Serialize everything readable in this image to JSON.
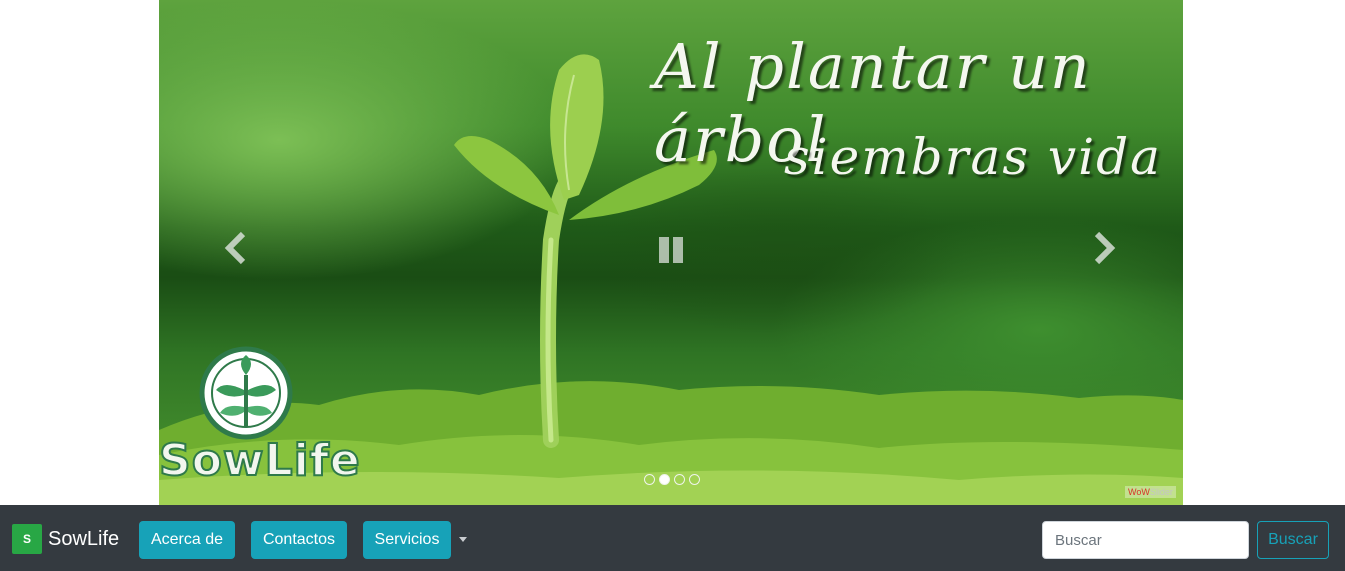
{
  "slider": {
    "quote_line1": "Al plantar un árbol",
    "quote_line2": "siembras vida",
    "logo_text": "SowLife",
    "watermark_brand": "WoW",
    "watermark_suffix": "Slider",
    "bullets": [
      {
        "active": false
      },
      {
        "active": true
      },
      {
        "active": false
      },
      {
        "active": false
      }
    ]
  },
  "navbar": {
    "brand_icon_letter": "S",
    "brand_name": "SowLife",
    "items": [
      {
        "label": "Acerca de"
      },
      {
        "label": "Contactos"
      },
      {
        "label": "Servicios"
      }
    ],
    "search": {
      "placeholder": "Buscar",
      "value": "",
      "button_label": "Buscar"
    }
  },
  "colors": {
    "navbar_bg": "#343a40",
    "button_info": "#17a2b8",
    "brand_green": "#28a745"
  }
}
